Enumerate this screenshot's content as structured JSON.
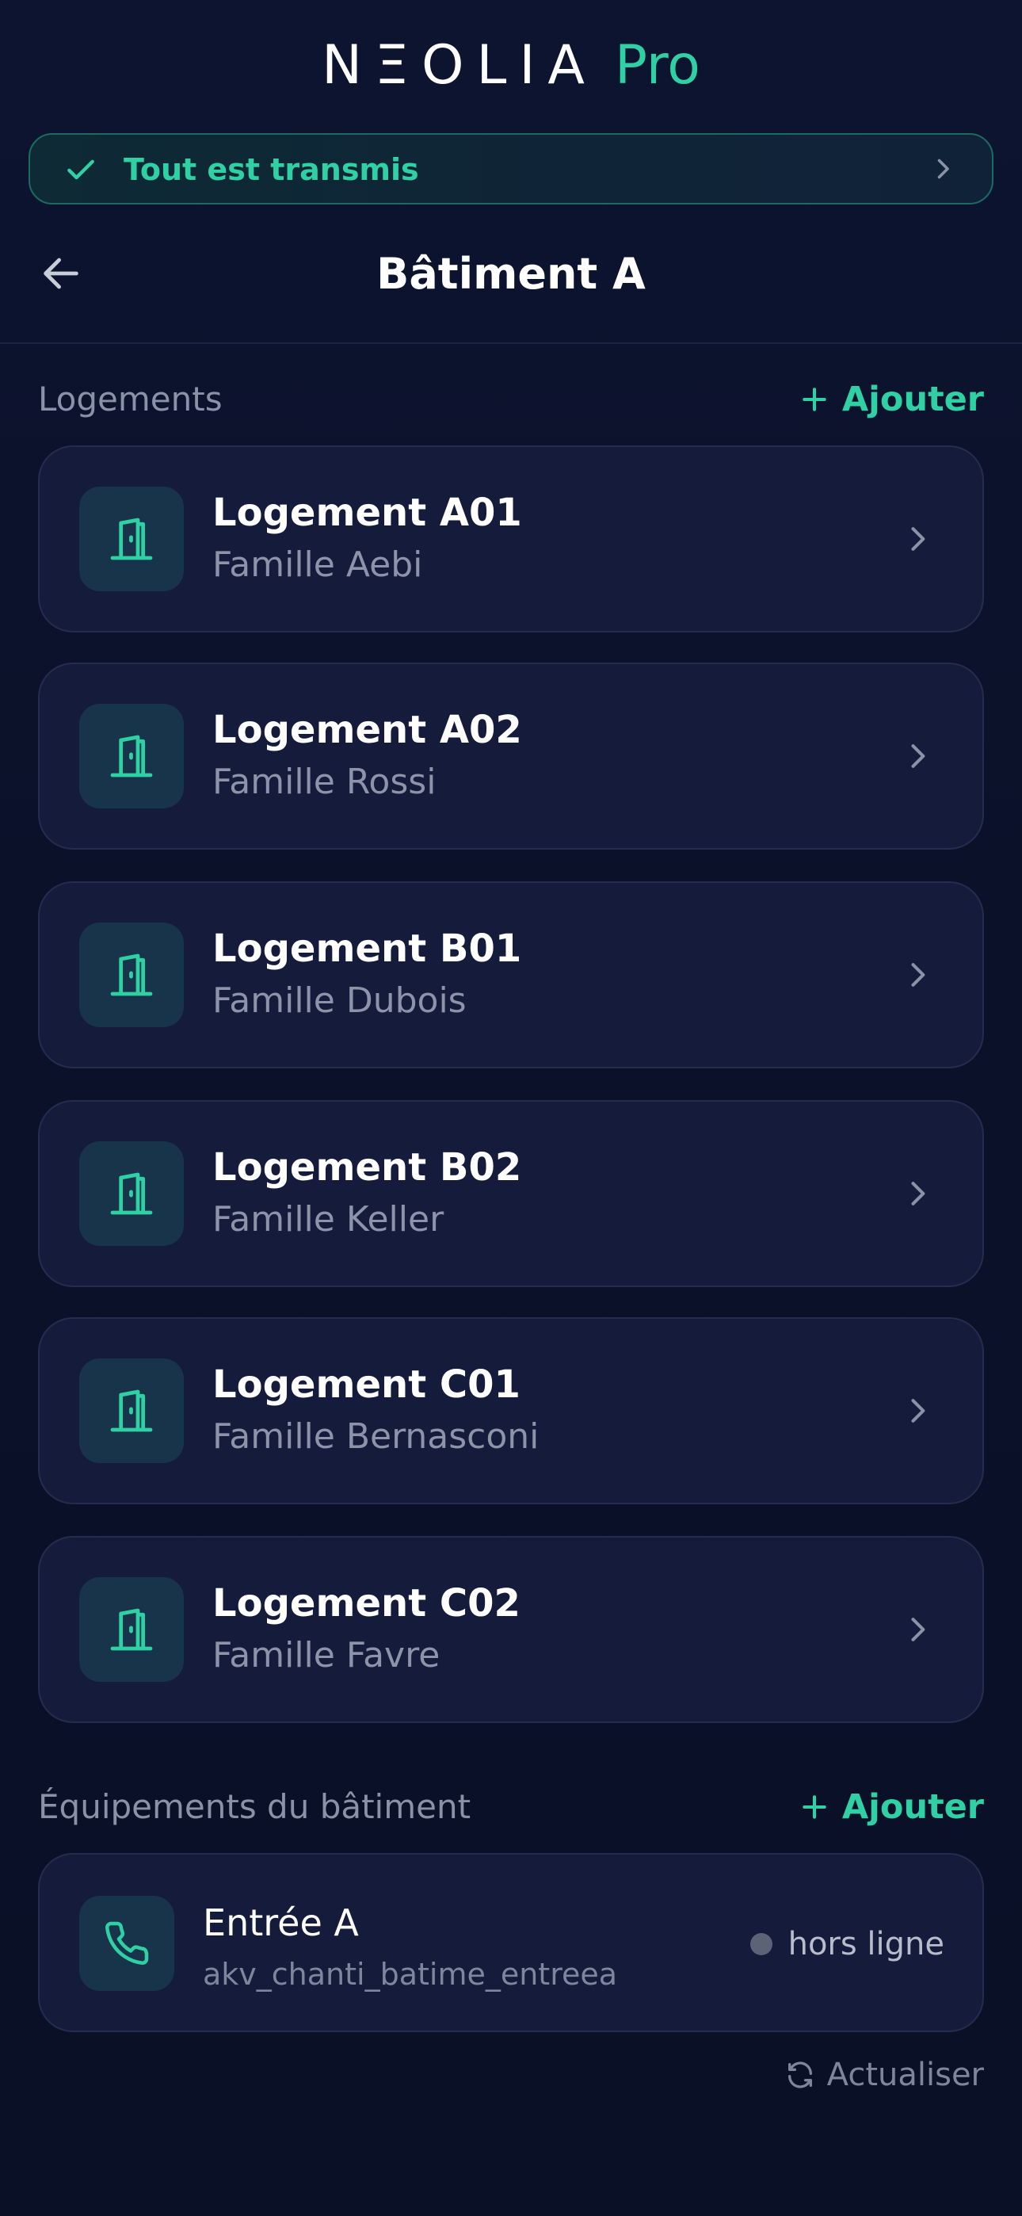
{
  "brand": {
    "name": "NΞOLIA",
    "suffix": "Pro"
  },
  "banner": {
    "text": "Tout est transmis",
    "icon": "check-icon"
  },
  "header": {
    "title": "Bâtiment A",
    "back_icon": "arrow-left-icon"
  },
  "logements": {
    "label": "Logements",
    "add_label": "Ajouter",
    "items": [
      {
        "title": "Logement A01",
        "subtitle": "Famille Aebi"
      },
      {
        "title": "Logement A02",
        "subtitle": "Famille Rossi"
      },
      {
        "title": "Logement B01",
        "subtitle": "Famille Dubois"
      },
      {
        "title": "Logement B02",
        "subtitle": "Famille Keller"
      },
      {
        "title": "Logement C01",
        "subtitle": "Famille Bernasconi"
      },
      {
        "title": "Logement C02",
        "subtitle": "Famille Favre"
      }
    ]
  },
  "equipements": {
    "label": "Équipements du bâtiment",
    "add_label": "Ajouter",
    "items": [
      {
        "title": "Entrée A",
        "id": "akv_chanti_batime_entreea",
        "status": "hors ligne",
        "icon": "phone-icon"
      }
    ]
  },
  "refresh_label": "Actualiser",
  "colors": {
    "accent": "#2fd0a4",
    "background": "#0b1129",
    "card": "#151b3b",
    "status_offline": "#5d6377"
  }
}
